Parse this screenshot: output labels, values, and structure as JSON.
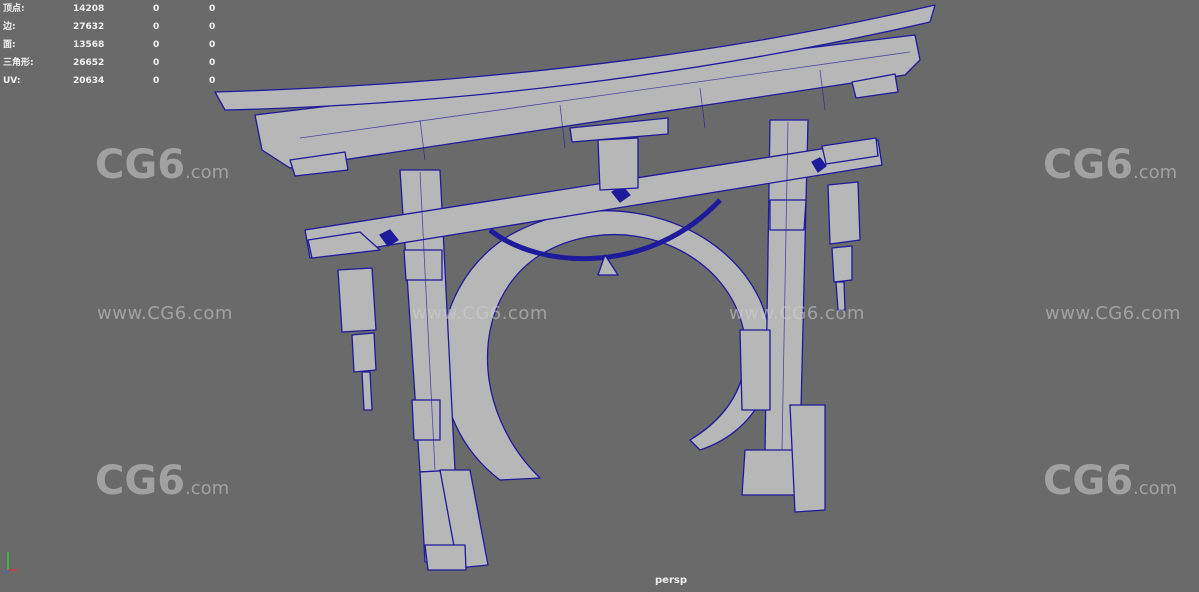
{
  "stats": [
    {
      "label": "顶点:",
      "a": "14208",
      "b": "0",
      "c": "0"
    },
    {
      "label": "边:",
      "a": "27632",
      "b": "0",
      "c": "0"
    },
    {
      "label": "面:",
      "a": "13568",
      "b": "0",
      "c": "0"
    },
    {
      "label": "三角形:",
      "a": "26652",
      "b": "0",
      "c": "0"
    },
    {
      "label": "UV:",
      "a": "20634",
      "b": "0",
      "c": "0"
    }
  ],
  "camera_label": "persp",
  "watermark": {
    "url": "www.CG6.com",
    "logo": "CG6",
    "logo_suffix": ".com"
  },
  "colors": {
    "background": "#6a6a6a",
    "wire": "#1e1a9c",
    "fill": "#b7b7b7",
    "text": "#f2f2f2"
  }
}
